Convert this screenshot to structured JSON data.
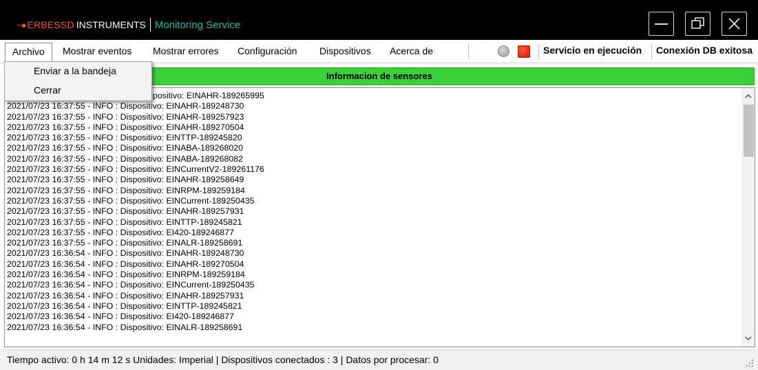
{
  "titlebar": {
    "brand_mark": "~●",
    "brand_name": "ERBESSD",
    "brand_name2": "INSTRUMENTS",
    "service_name": "Monitoring Service",
    "icons": [
      "minimize-icon",
      "restore-icon",
      "close-icon"
    ]
  },
  "menu": {
    "items": [
      {
        "label": "Archivo"
      },
      {
        "label": "Mostrar eventos"
      },
      {
        "label": "Mostrar errores"
      },
      {
        "label": "Configuración"
      },
      {
        "label": "Dispositivos"
      },
      {
        "label": "Acerca de"
      }
    ],
    "dropdown": [
      "Enviar a la bandeja",
      "Cerrar"
    ]
  },
  "status_indicators": {
    "service_status": "Servicio en ejecución",
    "db_status": "Conexión DB exitosa",
    "gray_led_color": "#a8a8a8",
    "red_led_color": "#e02a0a"
  },
  "panel": {
    "title": "Informacion de sensores",
    "header_color": "#3ccf3c"
  },
  "log": {
    "first_line_visible": "positivo: EINAHR-189265995",
    "lines": [
      "2021/07/23 16:37:55 - INFO : Dispositivo: EINAHR-189248730",
      "2021/07/23 16:37:55 - INFO : Dispositivo: EINAHR-189257923",
      "2021/07/23 16:37:55 - INFO : Dispositivo: EINAHR-189270504",
      "2021/07/23 16:37:55 - INFO : Dispositivo: EINTTP-189245820",
      "2021/07/23 16:37:55 - INFO : Dispositivo: EINABA-189268020",
      "2021/07/23 16:37:55 - INFO : Dispositivo: EINABA-189268082",
      "2021/07/23 16:37:55 - INFO : Dispositivo: EINCurrentV2-189261176",
      "2021/07/23 16:37:55 - INFO : Dispositivo: EINAHR-189258649",
      "2021/07/23 16:37:55 - INFO : Dispositivo: EINRPM-189259184",
      "2021/07/23 16:37:55 - INFO : Dispositivo: EINCurrent-189250435",
      "2021/07/23 16:37:55 - INFO : Dispositivo: EINAHR-189257931",
      "2021/07/23 16:37:55 - INFO : Dispositivo: EINTTP-189245821",
      "2021/07/23 16:37:55 - INFO : Dispositivo: EI420-189246877",
      "2021/07/23 16:37:55 - INFO : Dispositivo: EINALR-189258691",
      "2021/07/23 16:36:54 - INFO : Dispositivo: EINAHR-189248730",
      "2021/07/23 16:36:54 - INFO : Dispositivo: EINAHR-189270504",
      "2021/07/23 16:36:54 - INFO : Dispositivo: EINRPM-189259184",
      "2021/07/23 16:36:54 - INFO : Dispositivo: EINCurrent-189250435",
      "2021/07/23 16:36:54 - INFO : Dispositivo: EINAHR-189257931",
      "2021/07/23 16:36:54 - INFO : Dispositivo: EINTTP-189245821",
      "2021/07/23 16:36:54 - INFO : Dispositivo: EI420-189246877",
      "2021/07/23 16:36:54 - INFO : Dispositivo: EINALR-189258691"
    ]
  },
  "statusbar": {
    "text": "Tiempo activo:  0 h 14 m 12 s  Unidades: Imperial  |  Dispositivos conectados : 3  |  Datos por procesar:  0"
  }
}
